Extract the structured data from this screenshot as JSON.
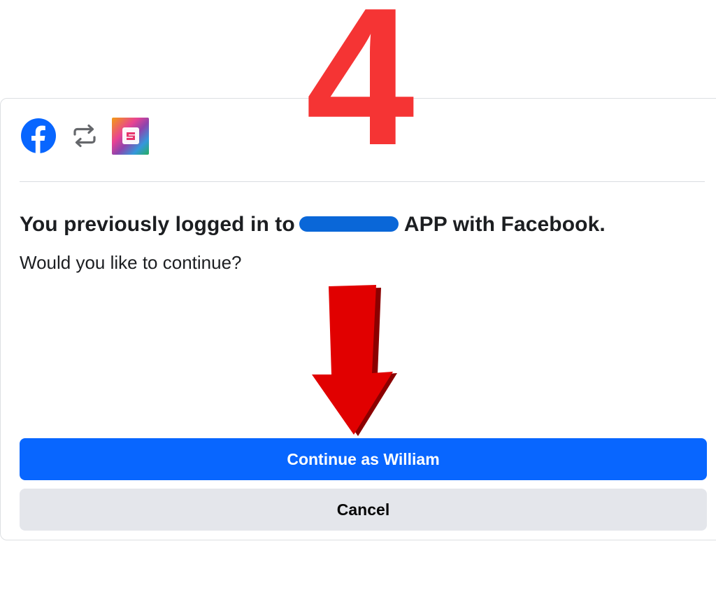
{
  "annotation": {
    "step_number": "4",
    "step_color": "#f53434",
    "arrow_icon": "down-arrow-icon",
    "arrow_color": "#e10000"
  },
  "header": {
    "icons": [
      "facebook-icon",
      "swap-icon",
      "app-icon"
    ]
  },
  "dialog": {
    "heading_prefix": "You previously logged in to",
    "heading_suffix": "APP with Facebook.",
    "subtext": "Would you like to continue?",
    "continue_label": "Continue as William",
    "cancel_label": "Cancel"
  },
  "colors": {
    "primary": "#0866ff",
    "secondary": "#e4e6eb",
    "redaction": "#0a67d8",
    "text": "#1c1e21"
  }
}
